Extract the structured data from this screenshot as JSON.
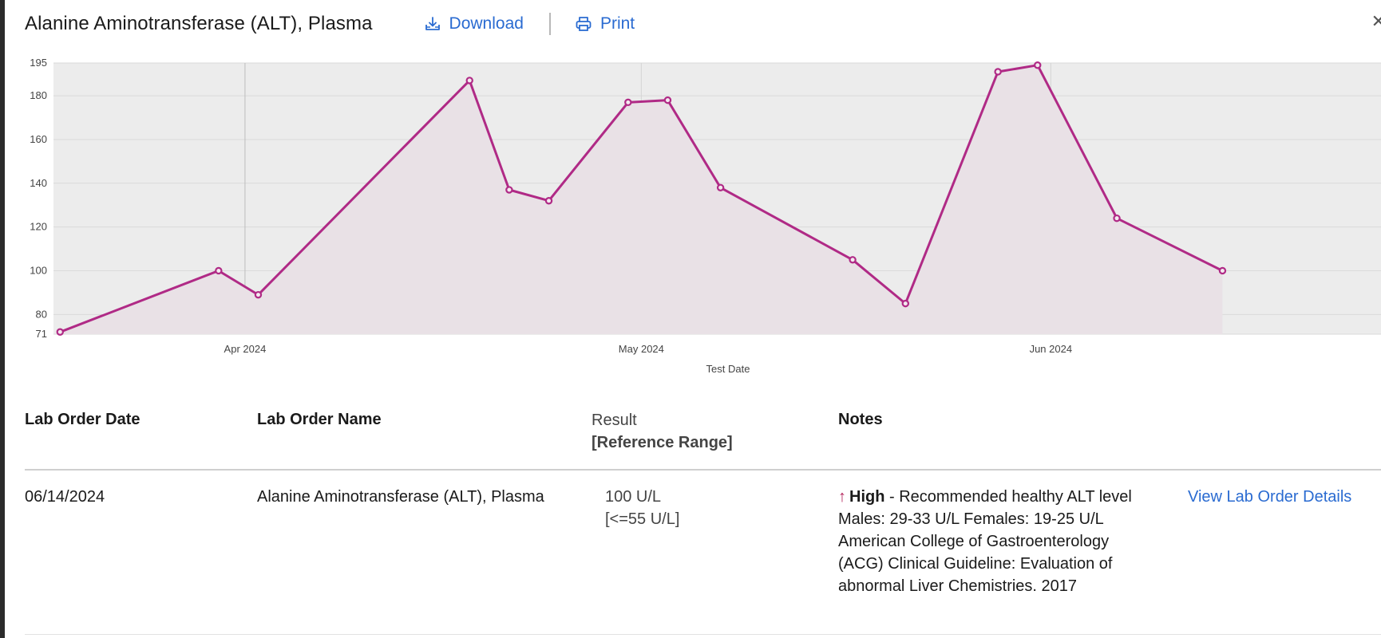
{
  "header": {
    "title": "Alanine Aminotransferase (ALT), Plasma",
    "download_label": "Download",
    "print_label": "Print"
  },
  "chart_data": {
    "type": "area",
    "title": "",
    "xlabel": "Test Date",
    "ylabel": "",
    "ylim": [
      71,
      195
    ],
    "yticks": [
      71,
      80,
      100,
      120,
      140,
      160,
      180,
      195
    ],
    "xlim": [
      "2024-03-18",
      "2024-06-26"
    ],
    "xticks": [
      {
        "date": "2024-04-01",
        "label": "Apr 2024"
      },
      {
        "date": "2024-05-01",
        "label": "May 2024"
      },
      {
        "date": "2024-06-01",
        "label": "Jun 2024"
      }
    ],
    "grid": true,
    "series": [
      {
        "color": "#b02a86",
        "points": [
          {
            "x": "2024-03-18",
            "y": 72
          },
          {
            "x": "2024-03-30",
            "y": 100
          },
          {
            "x": "2024-04-02",
            "y": 89
          },
          {
            "x": "2024-04-18",
            "y": 187
          },
          {
            "x": "2024-04-21",
            "y": 137
          },
          {
            "x": "2024-04-24",
            "y": 132
          },
          {
            "x": "2024-04-30",
            "y": 177
          },
          {
            "x": "2024-05-03",
            "y": 178
          },
          {
            "x": "2024-05-07",
            "y": 138
          },
          {
            "x": "2024-05-17",
            "y": 105
          },
          {
            "x": "2024-05-21",
            "y": 85
          },
          {
            "x": "2024-05-28",
            "y": 191
          },
          {
            "x": "2024-05-31",
            "y": 194
          },
          {
            "x": "2024-06-06",
            "y": 124
          },
          {
            "x": "2024-06-14",
            "y": 100
          }
        ]
      }
    ]
  },
  "table": {
    "headers": {
      "order_date": "Lab Order Date",
      "order_name": "Lab Order Name",
      "result_line1": "Result",
      "result_line2": "[Reference Range]",
      "notes": "Notes"
    },
    "rows": [
      {
        "order_date": "06/14/2024",
        "order_name": "Alanine Aminotransferase (ALT), Plasma",
        "result": "100 U/L",
        "reference": "[<=55 U/L]",
        "flag": "High",
        "notes_text": " - Recommended healthy ALT level Males: 29-33 U/L Females: 19-25 U/L American College of Gastroenterology (ACG) Clinical Guideline: Evaluation of abnormal Liver Chemistries. 2017",
        "link_label": "View Lab Order Details"
      }
    ]
  },
  "colors": {
    "accent": "#2a6bd1",
    "series": "#b02a86",
    "plot_bg": "#ececec",
    "area_fill": "#e9e1e6",
    "flag_arrow": "#b5275d"
  }
}
